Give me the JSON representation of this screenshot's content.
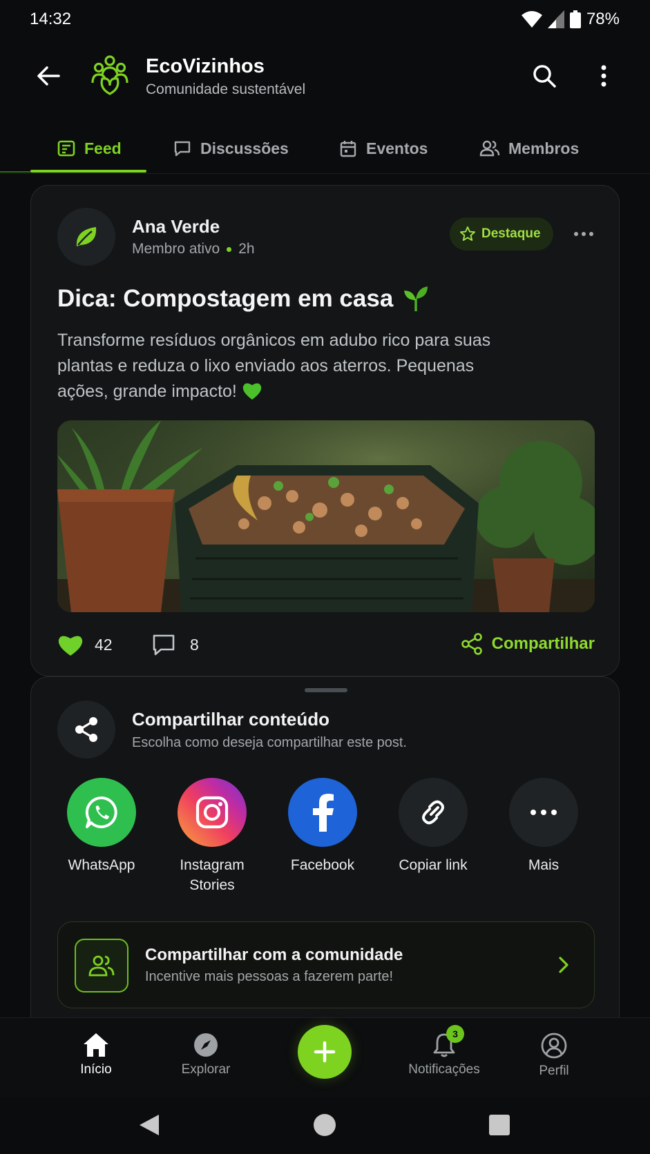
{
  "status": {
    "time": "14:32",
    "battery": "78%"
  },
  "appbar": {
    "title": "EcoVizinhos",
    "subtitle": "Comunidade sustentável"
  },
  "tabs": [
    {
      "label": "Feed",
      "icon": "feed-icon",
      "active": true
    },
    {
      "label": "Discussões",
      "icon": "chat-icon",
      "active": false
    },
    {
      "label": "Eventos",
      "icon": "calendar-icon",
      "active": false
    },
    {
      "label": "Membros",
      "icon": "members-icon",
      "active": false
    }
  ],
  "post": {
    "author": "Ana Verde",
    "role": "Membro ativo",
    "time": "2h",
    "badge": "Destaque",
    "title": "Dica: Compostagem em casa",
    "body": "Transforme resíduos orgânicos em adubo rico para suas plantas e reduza o lixo enviado aos aterros. Pequenas ações, grande impacto!",
    "likes": "42",
    "comments": "8",
    "share_label": "Compartilhar"
  },
  "share_sheet": {
    "title": "Compartilhar conteúdo",
    "subtitle": "Escolha como deseja compartilhar este post.",
    "options": [
      {
        "label": "WhatsApp",
        "icon": "whatsapp-icon"
      },
      {
        "label": "Instagram Stories",
        "icon": "instagram-icon"
      },
      {
        "label": "Facebook",
        "icon": "facebook-icon"
      },
      {
        "label": "Copiar link",
        "icon": "link-icon"
      },
      {
        "label": "Mais",
        "icon": "more-icon"
      }
    ],
    "community": {
      "title": "Compartilhar com a comunidade",
      "subtitle": "Incentive mais pessoas a fazerem parte!"
    }
  },
  "bottom_nav": {
    "items": [
      {
        "label": "Início",
        "icon": "home-icon",
        "active": true
      },
      {
        "label": "Explorar",
        "icon": "compass-icon",
        "active": false
      },
      {
        "label": "Notificações",
        "icon": "bell-icon",
        "active": false,
        "badge": "3"
      },
      {
        "label": "Perfil",
        "icon": "profile-icon",
        "active": false
      }
    ]
  },
  "colors": {
    "accent": "#7ed321",
    "background": "#0b0c0d",
    "card": "#131517"
  }
}
